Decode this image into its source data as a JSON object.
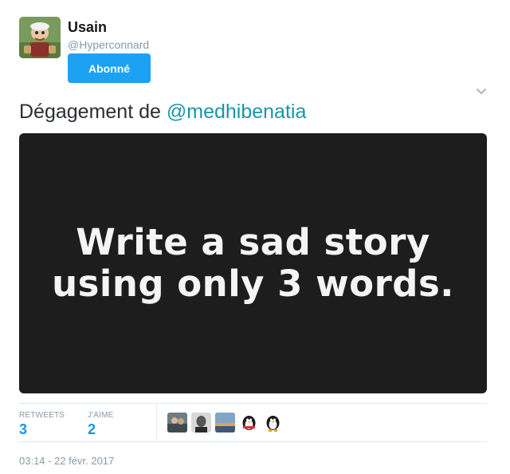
{
  "user": {
    "display_name": "Usain",
    "handle": "@Hyperconnard",
    "follow_label": "Abonné"
  },
  "tweet": {
    "text_prefix": "Dégagement de ",
    "mention": "@medhibenatia",
    "media_lines": [
      "Write a sad story",
      "using only 3 words."
    ]
  },
  "stats": {
    "retweets_label": "RETWEETS",
    "retweets_value": "3",
    "likes_label": "J'AIME",
    "likes_value": "2"
  },
  "likers": [
    "avatar-1",
    "avatar-2",
    "avatar-3",
    "penguin-avatar-4",
    "penguin-avatar-5"
  ],
  "timestamp": "03:14 - 22 févr. 2017",
  "colors": {
    "accent": "#1da1f2",
    "mention": "#1b95a8",
    "stat_value": "#1b95e0",
    "muted": "#8899a6",
    "media_bg": "#1d1d1d"
  }
}
